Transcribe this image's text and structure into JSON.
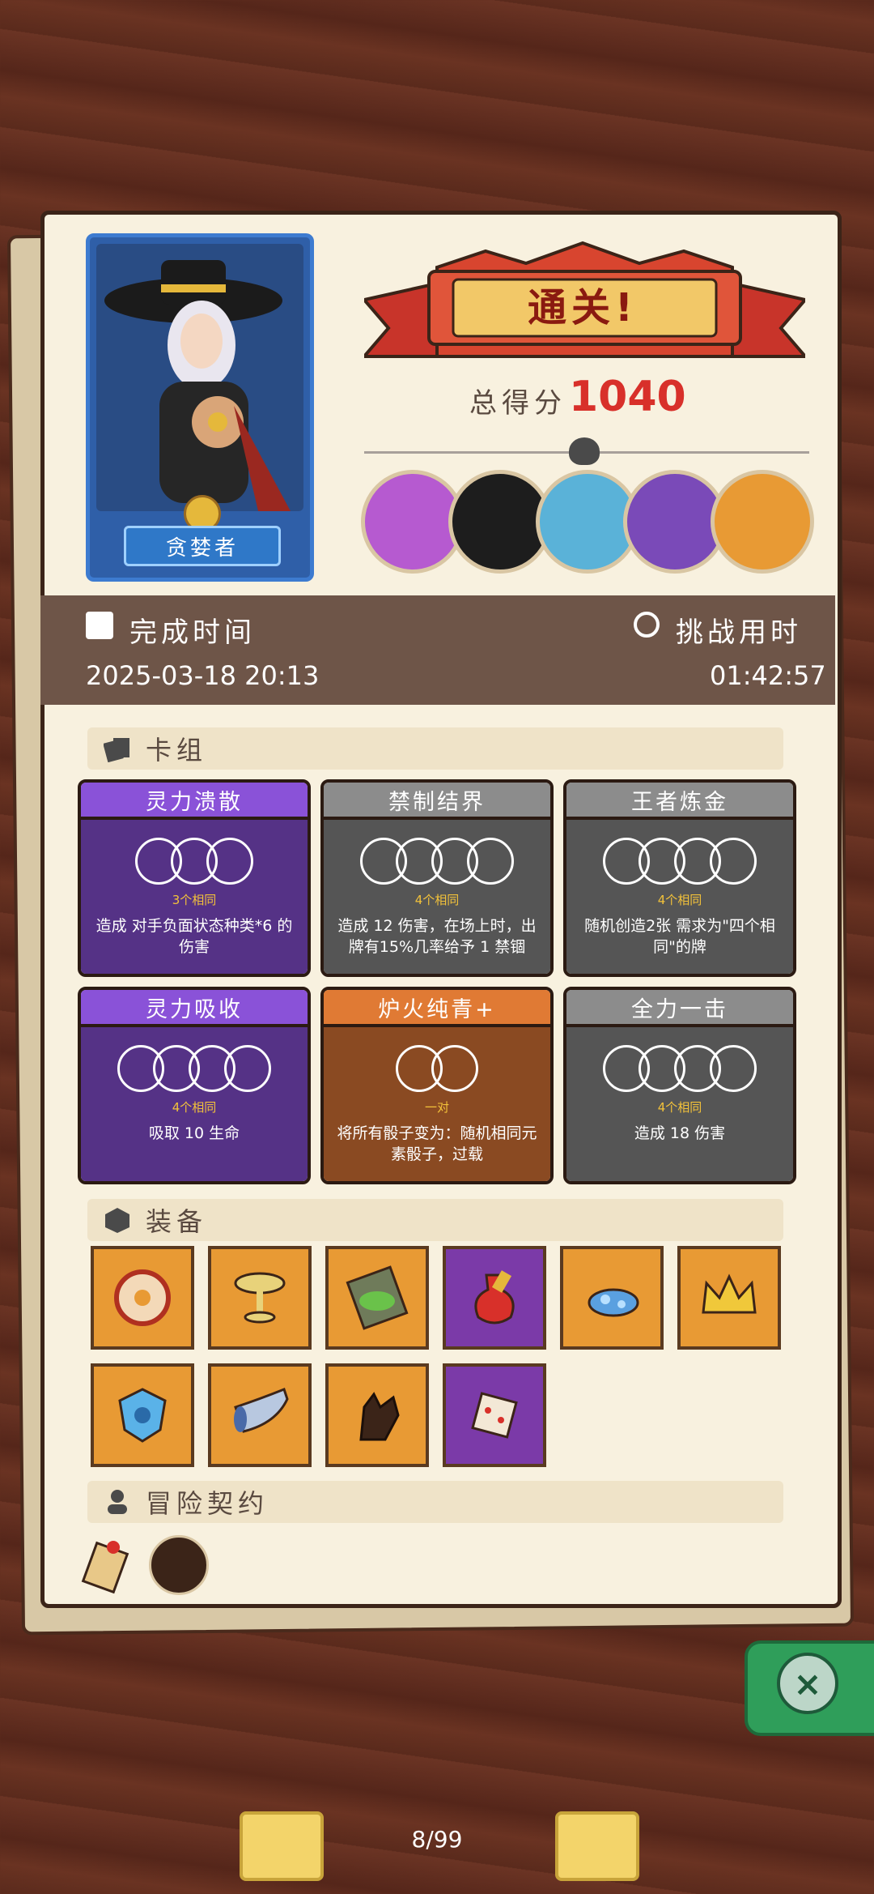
{
  "hero": {
    "name": "贪婪者"
  },
  "result": {
    "title": "通关!",
    "score_label": "总得分",
    "score": "1040"
  },
  "bosses": [
    "boss-1",
    "boss-2",
    "boss-3",
    "boss-4",
    "boss-5"
  ],
  "info": {
    "finish_time_label": "完成时间",
    "finish_time": "2025-03-18 20:13",
    "duration_label": "挑战用时",
    "duration": "01:42:57"
  },
  "deck": {
    "label": "卡组",
    "cards": [
      {
        "name": "灵力溃散",
        "dice": 3,
        "count": "3个相同",
        "desc": "造成 对手负面状态种类*6 的伤害",
        "color": "#553286"
      },
      {
        "name": "禁制结界",
        "dice": 4,
        "count": "4个相同",
        "desc": "造成 12 伤害，在场上时，出牌有15%几率给予 1 禁锢",
        "color": "#555555"
      },
      {
        "name": "王者炼金",
        "dice": 4,
        "count": "4个相同",
        "desc": "随机创造2张 需求为\"四个相同\"的牌",
        "color": "#555555"
      },
      {
        "name": "灵力吸收",
        "dice": 4,
        "count": "4个相同",
        "desc": "吸取 10 生命",
        "color": "#553286"
      },
      {
        "name": "炉火纯青+",
        "dice": 2,
        "count": "一对",
        "desc": "将所有骰子变为：随机相同元素骰子，过载",
        "color": "#8a4a22"
      },
      {
        "name": "全力一击",
        "dice": 4,
        "count": "4个相同",
        "desc": "造成 18 伤害",
        "color": "#555555"
      }
    ]
  },
  "equipment": {
    "label": "装备",
    "items": [
      "donut-icon",
      "chalice-icon",
      "slime-tome-icon",
      "red-flask-icon",
      "blue-stone-icon",
      "crown-icon",
      "blue-shield-icon",
      "horn-icon",
      "dark-glove-icon",
      "spiked-die-icon"
    ]
  },
  "contract": {
    "label": "冒险契约",
    "items": [
      "scroll-icon",
      "pipe-icon"
    ]
  },
  "pager": {
    "text": "8/99"
  }
}
